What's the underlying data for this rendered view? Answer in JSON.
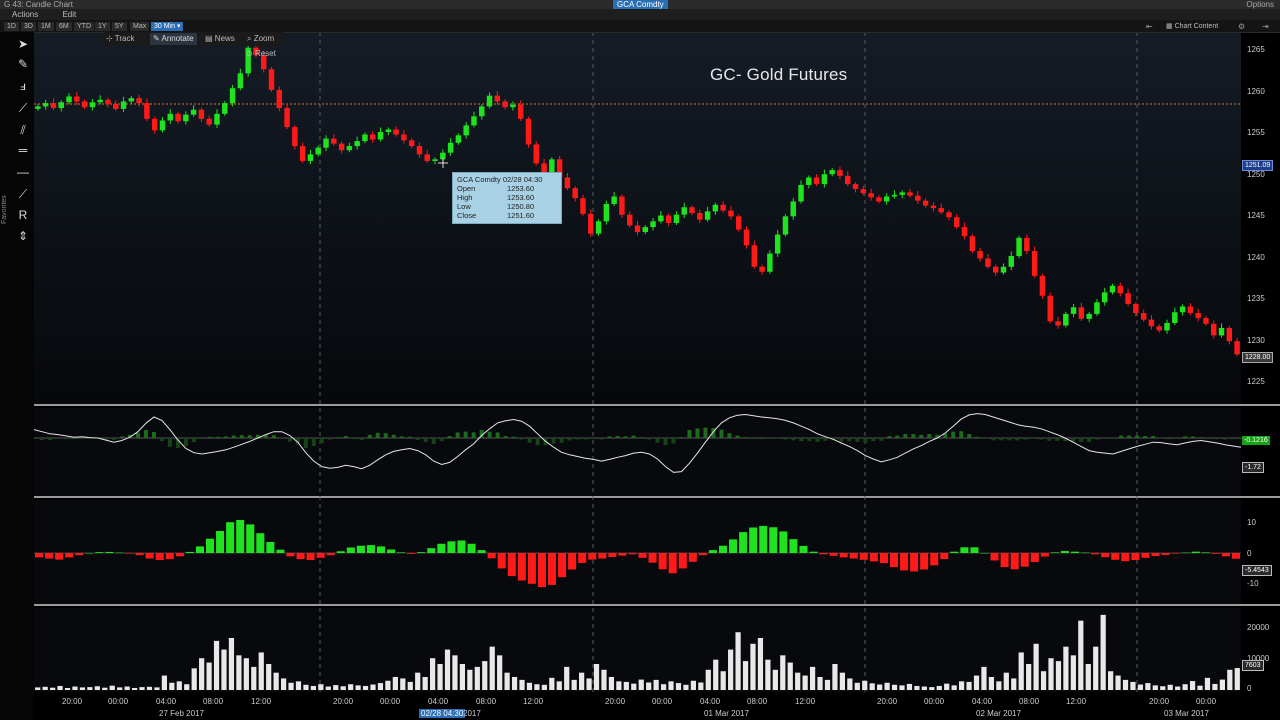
{
  "window": {
    "title": "G 43: Candle Chart",
    "security_tab": "GCA Comdty",
    "options_label": "Options"
  },
  "menu": {
    "items": [
      "Actions",
      "Edit"
    ]
  },
  "toolbar": {
    "ranges": [
      "1D",
      "3D",
      "1M",
      "6M",
      "YTD",
      "1Y",
      "5Y",
      "Max",
      "30 Min"
    ],
    "active_range": "30 Min",
    "chart_content_label": "Chart Content"
  },
  "annotation_bar": {
    "track": "Track",
    "annotate": "Annotate",
    "news": "News",
    "zoom": "Zoom",
    "reset": "Reset"
  },
  "left_tools": [
    "pointer-icon",
    "pen-icon",
    "fibonacci-icon",
    "trendline-icon",
    "channel-icon",
    "parallel-lines-icon",
    "horizontal-line-icon",
    "ray-icon",
    "text-r-icon",
    "measure-icon"
  ],
  "favorites_label": "Favorites",
  "chart_title": "GC- Gold Futures",
  "tooltip": {
    "header": "GCA Comdty 02/28 04:30",
    "rows": [
      {
        "label": "Open",
        "value": "1253.60"
      },
      {
        "label": "High",
        "value": "1253.60"
      },
      {
        "label": "Low",
        "value": "1250.80"
      },
      {
        "label": "Close",
        "value": "1251.60"
      }
    ]
  },
  "price_axis": {
    "labels": [
      "1265",
      "1260",
      "1255",
      "1250",
      "1245",
      "1240",
      "1235",
      "1230",
      "1225"
    ],
    "last_tag": "1228.00",
    "ref_tag": "1251.09"
  },
  "osc_axis": {
    "tag_green": "-0.1216",
    "tag_line": "-1.72"
  },
  "hist_axis": {
    "labels": [
      "10",
      "0",
      "-10"
    ],
    "tag": "-5.4543"
  },
  "volume_axis": {
    "labels": [
      "20000",
      "10000",
      "0"
    ],
    "tag": "7603"
  },
  "time_axis": {
    "labels": [
      "20:00",
      "00:00",
      "04:00",
      "08:00",
      "12:00",
      "20:00",
      "00:00",
      "04:00",
      "08:00",
      "12:00",
      "20:00",
      "00:00",
      "04:00",
      "08:00",
      "12:00",
      "20:00",
      "00:00",
      "04:00",
      "08:00",
      "12:00",
      "20:00",
      "00:00"
    ],
    "dates": [
      "27 Feb 2017",
      "02/28 04:30",
      "2017",
      "01 Mar 2017",
      "02 Mar 2017",
      "03 Mar 2017"
    ]
  },
  "colors": {
    "up": "#1ee31e",
    "down": "#ff1a1a",
    "bg": "#0a0e14",
    "orange_line": "#e0782a",
    "tooltip": "#a9d1e6",
    "highlight": "#2a6fb5"
  },
  "chart_data": {
    "type": "candlestick",
    "ylim": [
      1222,
      1267
    ],
    "reference_line": 1258.6,
    "last_price": 1228.0,
    "closes": [
      1258.0,
      1258.4,
      1257.8,
      1258.5,
      1259.2,
      1258.6,
      1257.9,
      1258.5,
      1258.8,
      1258.3,
      1257.7,
      1258.6,
      1259.0,
      1258.4,
      1256.5,
      1255.1,
      1256.3,
      1257.1,
      1256.2,
      1257.0,
      1257.6,
      1256.5,
      1255.8,
      1257.1,
      1258.4,
      1260.2,
      1262.0,
      1265.1,
      1264.2,
      1262.5,
      1260.0,
      1257.8,
      1255.5,
      1253.2,
      1251.4,
      1252.2,
      1253.0,
      1254.1,
      1253.5,
      1252.7,
      1253.2,
      1253.8,
      1254.6,
      1254.0,
      1254.9,
      1255.2,
      1254.6,
      1253.9,
      1253.2,
      1252.2,
      1251.4,
      1251.6,
      1252.4,
      1253.6,
      1254.5,
      1255.7,
      1256.8,
      1258.0,
      1259.3,
      1258.6,
      1257.9,
      1258.2,
      1256.5,
      1253.4,
      1251.1,
      1250.0,
      1251.6,
      1249.4,
      1248.1,
      1246.9,
      1245.0,
      1242.6,
      1244.1,
      1246.2,
      1247.1,
      1244.9,
      1243.6,
      1242.8,
      1243.4,
      1244.1,
      1244.8,
      1243.9,
      1244.9,
      1245.8,
      1245.1,
      1244.3,
      1245.3,
      1246.1,
      1245.4,
      1244.7,
      1243.1,
      1241.2,
      1238.6,
      1238.0,
      1240.2,
      1242.5,
      1244.7,
      1246.5,
      1248.5,
      1249.4,
      1248.6,
      1249.8,
      1250.3,
      1249.6,
      1248.6,
      1248.0,
      1247.5,
      1247.0,
      1246.5,
      1247.1,
      1247.3,
      1247.6,
      1247.2,
      1246.6,
      1246.0,
      1245.7,
      1245.2,
      1244.6,
      1243.4,
      1242.3,
      1240.5,
      1239.6,
      1238.6,
      1237.9,
      1238.6,
      1239.9,
      1242.1,
      1240.5,
      1237.5,
      1235.1,
      1232.0,
      1231.5,
      1232.9,
      1233.7,
      1232.3,
      1232.9,
      1234.3,
      1235.5,
      1236.3,
      1235.4,
      1234.1,
      1233.0,
      1232.2,
      1231.4,
      1230.9,
      1231.8,
      1233.1,
      1233.8,
      1233.0,
      1232.4,
      1231.7,
      1230.3,
      1231.2,
      1229.6,
      1228.0
    ],
    "oscillator": [
      2,
      1.5,
      1,
      0.8,
      0.5,
      0.2,
      0.3,
      0.1,
      0,
      -0.5,
      -1,
      -0.6,
      0.2,
      1.5,
      3.5,
      5,
      4.2,
      2,
      -0.5,
      -2.5,
      -3.5,
      -3.8,
      -3.5,
      -3.2,
      -2.8,
      -2.2,
      -1.5,
      -0.8,
      0,
      0.8,
      1.5,
      1.5,
      0.6,
      -1,
      -3.5,
      -5.5,
      -6.8,
      -7.2,
      -7,
      -6.5,
      -6.8,
      -7.3,
      -6.5,
      -5.2,
      -4,
      -3.2,
      -2.8,
      -2.5,
      -3,
      -4,
      -5.5,
      -6.3,
      -5.8,
      -4.4,
      -2.8,
      -1.4,
      0.6,
      2.2,
      3.6,
      4.1,
      4.4,
      4,
      2.8,
      1,
      -0.8,
      -2.2,
      -3.4,
      -4,
      -4.4,
      -4.8,
      -5.1,
      -5.5,
      -5.1,
      -4.6,
      -4.2,
      -3.6,
      -3.4,
      -3.8,
      -5,
      -6.8,
      -8.2,
      -8,
      -6,
      -3.6,
      -1,
      1.5,
      3.6,
      4.8,
      5.4,
      5.6,
      5.3,
      5,
      4.8,
      4.6,
      4.2,
      3.6,
      2.8,
      2,
      1,
      0.3,
      -0.3,
      -1.2,
      -2,
      -3,
      -4.2,
      -5,
      -5.7,
      -5.2,
      -4.6,
      -3.6,
      -2.6,
      -1.8,
      -0.8,
      0,
      1.2,
      2.8,
      4.5,
      5.5,
      5.8,
      5.6,
      5,
      4.4,
      3.8,
      3.2,
      2.8,
      2.6,
      2.2,
      1.5,
      0.8,
      0,
      -1,
      -2,
      -3,
      -3.4,
      -3.6,
      -3.8,
      -3.2,
      -2.6,
      -2,
      -1.5,
      -1,
      -1.1,
      -1.4,
      -1.6,
      -1.2,
      -0.8,
      -0.6,
      -0.9,
      -1.2,
      -1.6,
      -1.9,
      -2.2
    ],
    "histogram": [
      -2,
      -2.5,
      -3,
      -2,
      -1,
      0,
      0.4,
      0.5,
      0.2,
      -0.3,
      -1,
      -2.5,
      -3.2,
      -2.8,
      -1.5,
      0.5,
      3,
      6.5,
      10,
      14,
      15,
      13,
      9,
      5,
      1.5,
      -1.5,
      -2.8,
      -3.2,
      -2.2,
      -1,
      0.8,
      2.5,
      3.3,
      3.6,
      3,
      1.6,
      0.3,
      -0.4,
      0.4,
      2.2,
      4.2,
      5.3,
      5.7,
      4.2,
      1.3,
      -2.4,
      -7,
      -10.5,
      -12.5,
      -14,
      -15.5,
      -14.5,
      -11,
      -7.5,
      -4.5,
      -3,
      -2.5,
      -1.8,
      -1.2,
      -0.6,
      -2.2,
      -4.4,
      -7.4,
      -9.2,
      -7,
      -4,
      -1,
      1.3,
      3.3,
      6.2,
      9.5,
      11.6,
      12.3,
      11.7,
      9.8,
      6.3,
      3.2,
      0.6,
      -0.6,
      -1.3,
      -2,
      -2.5,
      -3.1,
      -3.8,
      -4.6,
      -6.4,
      -7.9,
      -8.4,
      -7.5,
      -5.6,
      -2.8,
      0.6,
      2.6,
      2.6,
      0,
      -3.4,
      -6.4,
      -7.4,
      -6.2,
      -4.1,
      -1.6,
      0.3,
      0.9,
      0.6,
      0.2,
      -0.6,
      -1.9,
      -3.1,
      -3.7,
      -3.2,
      -2.2,
      -1.4,
      -0.9,
      -0.3,
      0.2,
      0.6,
      0.3,
      -0.4,
      -1.5,
      -2.6
    ],
    "volume": [
      900,
      1100,
      800,
      1400,
      700,
      1200,
      900,
      1000,
      1300,
      800,
      1500,
      900,
      1200,
      700,
      1000,
      1100,
      900,
      5000,
      2500,
      3000,
      2000,
      7500,
      11000,
      9500,
      17000,
      14000,
      18000,
      12000,
      11000,
      8000,
      13000,
      9000,
      6000,
      4000,
      2500,
      3000,
      1800,
      1400,
      2000,
      1200,
      1700,
      1300,
      2000,
      1600,
      1400,
      1900,
      2400,
      3200,
      4500,
      4000,
      2800,
      6000,
      4500,
      11000,
      9000,
      14000,
      12000,
      9000,
      7000,
      8000,
      10000,
      15000,
      12000,
      6000,
      4500,
      3500,
      2500,
      2000,
      1800,
      4200,
      3000,
      8000,
      3500,
      6000,
      4000,
      9000,
      7000,
      4500,
      3000,
      2800,
      2200,
      3600,
      2600,
      3500,
      2000,
      3000,
      2400,
      1800,
      3200,
      2600,
      7000,
      10500,
      6500,
      14000,
      20000,
      10000,
      16000,
      18000,
      10500,
      7000,
      12000,
      9500,
      6000,
      5000,
      8000,
      4500,
      3500,
      9000,
      6000,
      4000,
      2500,
      3200,
      2300,
      1900,
      2500,
      1800,
      1600,
      2100,
      1400,
      1200,
      1000,
      1400,
      2200,
      1600,
      3000,
      2800,
      5000,
      8000,
      4500,
      3000,
      6000,
      4000,
      13000,
      9000,
      16000,
      6500,
      11000,
      10000,
      15000,
      12000,
      24000,
      9000,
      15000,
      26000,
      6500,
      5000,
      3500,
      2800,
      1900,
      2400,
      1600,
      1300,
      1800,
      1200,
      2000,
      3100,
      1500,
      4200,
      2100,
      3600,
      7000,
      7600
    ]
  }
}
